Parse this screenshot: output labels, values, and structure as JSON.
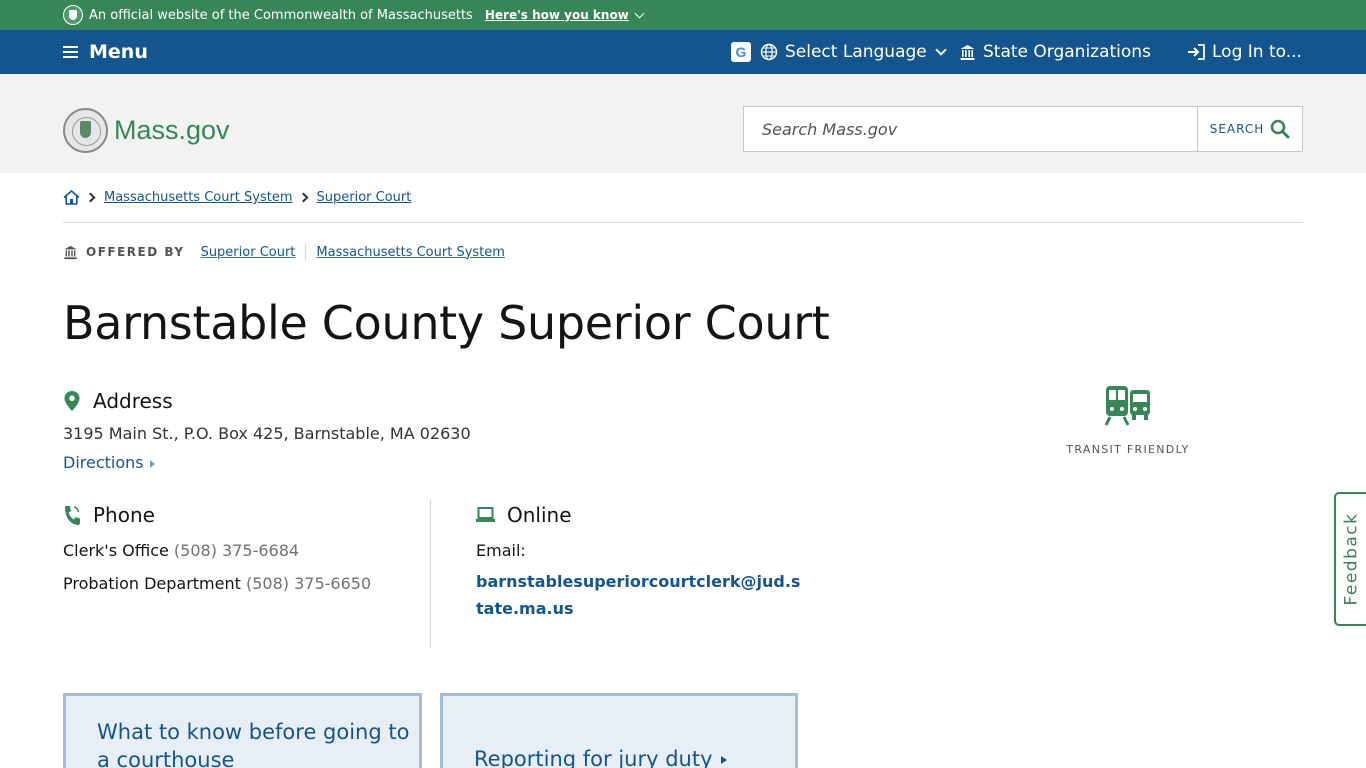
{
  "official_banner": {
    "text": "An official website of the Commonwealth of Massachusetts",
    "link": "Here's how you know"
  },
  "utility_nav": {
    "menu_label": "Menu",
    "language_label": "Select Language",
    "state_orgs_label": "State Organizations",
    "login_label": "Log In to..."
  },
  "header": {
    "logo_text": "Mass.gov",
    "search_placeholder": "Search Mass.gov",
    "search_button": "SEARCH"
  },
  "breadcrumb": {
    "items": [
      "Massachusetts Court System",
      "Superior Court"
    ]
  },
  "offered_by": {
    "label": "OFFERED BY",
    "links": [
      "Superior Court",
      "Massachusetts Court System"
    ]
  },
  "page_title": "Barnstable County Superior Court",
  "address": {
    "heading": "Address",
    "text": "3195 Main St., P.O. Box 425, Barnstable, MA 02630",
    "directions": "Directions"
  },
  "transit": {
    "label": "TRANSIT FRIENDLY"
  },
  "phone": {
    "heading": "Phone",
    "entries": [
      {
        "label": "Clerk's Office",
        "number": "(508) 375-6684"
      },
      {
        "label": "Probation Department",
        "number": "(508) 375-6650"
      }
    ]
  },
  "online": {
    "heading": "Online",
    "email_label": "Email:",
    "email": "barnstablesuperiorcourtclerk@jud.state.ma.us"
  },
  "cards": [
    {
      "label": "What to know before going to a courthouse"
    },
    {
      "label": "Reporting for jury duty"
    }
  ],
  "feedback_label": "Feedback",
  "colors": {
    "green": "#388557",
    "blue": "#14558f",
    "header_bg": "#f2f2f2"
  }
}
